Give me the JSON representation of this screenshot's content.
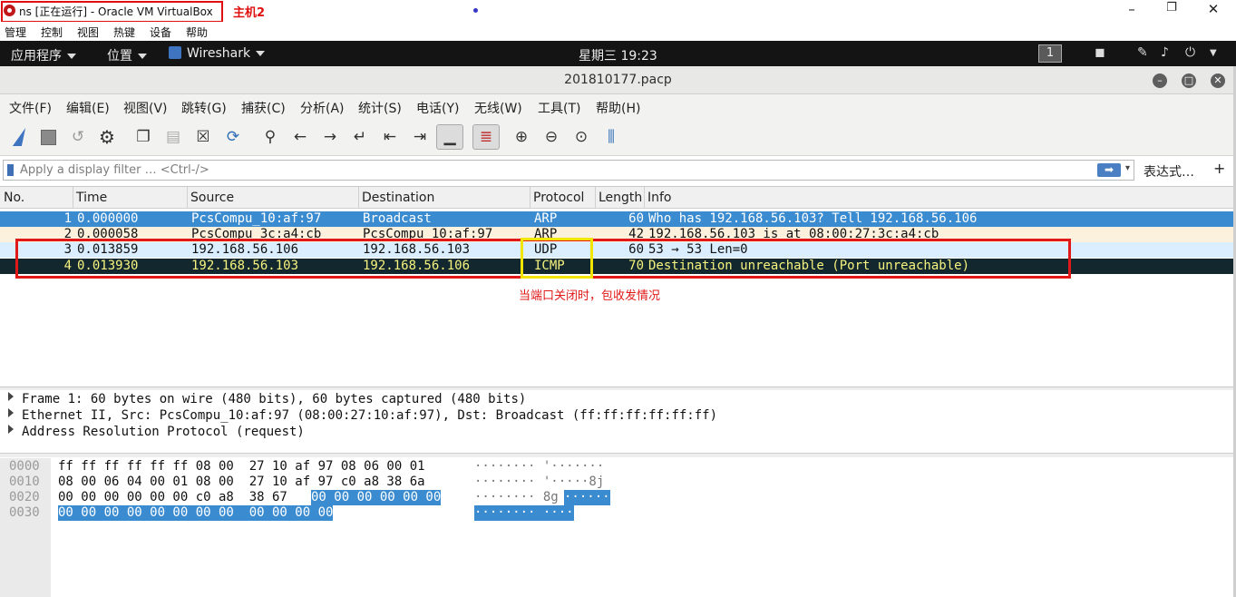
{
  "vbox": {
    "title": "ns [正在运行] - Oracle VM VirtualBox",
    "annotation": "主机2",
    "menu": [
      "管理",
      "控制",
      "视图",
      "热键",
      "设备",
      "帮助"
    ],
    "win_min": "–",
    "win_max": "❐",
    "win_close": "✕"
  },
  "gnome": {
    "apps": "应用程序",
    "places": "位置",
    "app_name": "Wireshark",
    "clock": "星期三 19:23",
    "workspace": "1"
  },
  "wireshark": {
    "title": "201810177.pacp",
    "menu": [
      "文件(F)",
      "编辑(E)",
      "视图(V)",
      "跳转(G)",
      "捕获(C)",
      "分析(A)",
      "统计(S)",
      "电话(Y)",
      "无线(W)",
      "工具(T)",
      "帮助(H)"
    ],
    "filter_placeholder": "Apply a display filter … <Ctrl-/>",
    "filter_apply": "➡",
    "filter_dropdown": "▾",
    "expression_label": "表达式…",
    "add_label": "+",
    "columns": [
      "No.",
      "Time",
      "Source",
      "Destination",
      "Protocol",
      "Length",
      "Info"
    ],
    "packets": [
      {
        "no": "1",
        "time": "0.000000",
        "src": "PcsCompu_10:af:97",
        "dst": "Broadcast",
        "proto": "ARP",
        "len": "60",
        "info": "Who has 192.168.56.103? Tell 192.168.56.106"
      },
      {
        "no": "2",
        "time": "0.000058",
        "src": "PcsCompu_3c:a4:cb",
        "dst": "PcsCompu_10:af:97",
        "proto": "ARP",
        "len": "42",
        "info": "192.168.56.103 is at 08:00:27:3c:a4:cb"
      },
      {
        "no": "3",
        "time": "0.013859",
        "src": "192.168.56.106",
        "dst": "192.168.56.103",
        "proto": "UDP",
        "len": "60",
        "info": "53 → 53 Len=0"
      },
      {
        "no": "4",
        "time": "0.013930",
        "src": "192.168.56.103",
        "dst": "192.168.56.106",
        "proto": "ICMP",
        "len": "70",
        "info": "Destination unreachable (Port unreachable)"
      }
    ],
    "note": "当端口关闭时，包收发情况",
    "details": [
      "Frame 1: 60 bytes on wire (480 bits), 60 bytes captured (480 bits)",
      "Ethernet II, Src: PcsCompu_10:af:97 (08:00:27:10:af:97), Dst: Broadcast (ff:ff:ff:ff:ff:ff)",
      "Address Resolution Protocol (request)"
    ],
    "bytes": [
      {
        "offset": "0000",
        "hex": "ff ff ff ff ff ff 08 00  27 10 af 97 08 06 00 01",
        "hex_sel": "",
        "ascii": "········ '·······",
        "ascii_sel": ""
      },
      {
        "offset": "0010",
        "hex": "08 00 06 04 00 01 08 00  27 10 af 97 c0 a8 38 6a",
        "hex_sel": "",
        "ascii": "········ '·····8j",
        "ascii_sel": ""
      },
      {
        "offset": "0020",
        "hex": "00 00 00 00 00 00 c0 a8  38 67 ",
        "hex_sel": "00 00 00 00 00 00",
        "ascii": "········ 8g",
        "ascii_sel": "······"
      },
      {
        "offset": "0030",
        "hex": "",
        "hex_sel": "00 00 00 00 00 00 00 00  00 00 00 00",
        "ascii": "",
        "ascii_sel": "········ ····"
      }
    ]
  },
  "colors": {
    "row1_bg": "#3a8bd0",
    "row2_bg": "#fbf1dc",
    "row3_bg": "#daeeff",
    "row4_bg": "#12272e",
    "row4_fg": "#f7f37e",
    "highlight_red": "#e01818",
    "highlight_yellow": "#f2e500"
  }
}
